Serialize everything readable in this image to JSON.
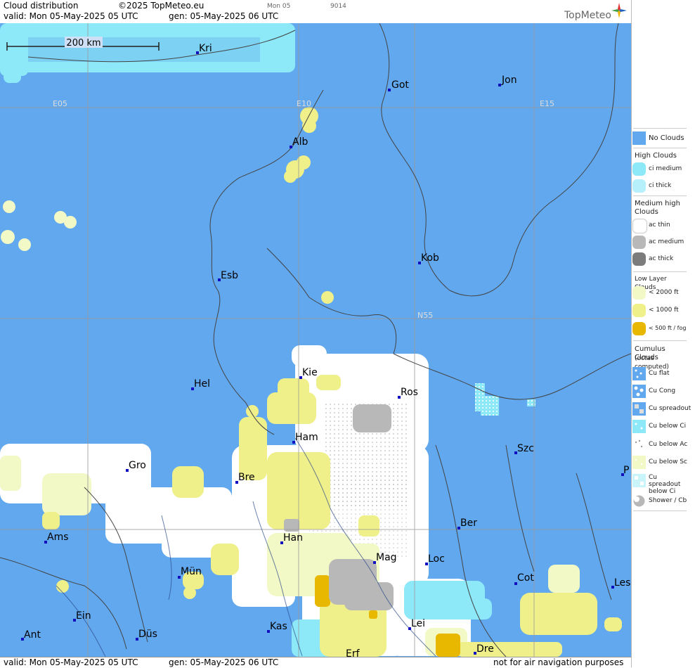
{
  "header": {
    "title": "Cloud distribution",
    "copyright": "©2025 TopMeteo.eu",
    "day_code": "Mon 05",
    "tile_code": "9014",
    "valid": "valid:  Mon  05-May-2025  05 UTC",
    "gen": "gen: 05-May-2025 06 UTC",
    "brand": "TopMeteo"
  },
  "footer": {
    "valid": "valid:  Mon  05-May-2025  05 UTC",
    "gen": "gen: 05-May-2025 06 UTC",
    "disclaimer": "not for air navigation purposes"
  },
  "map": {
    "scale_label": "200 km",
    "grid_labels": [
      "E05",
      "E10",
      "E15",
      "N55"
    ],
    "cities": [
      "Kri",
      "Got",
      "Jon",
      "Alb",
      "Kob",
      "Esb",
      "Kie",
      "Hel",
      "Ros",
      "Ham",
      "Szc",
      "Gro",
      "Bre",
      "P",
      "Ber",
      "Han",
      "Ams",
      "Mag",
      "Loc",
      "Mün",
      "Cot",
      "Les",
      "Ein",
      "Lei",
      "Kas",
      "Ant",
      "Düs",
      "Dre",
      "Erf"
    ]
  },
  "colors": {
    "no_clouds": "#62a8ee",
    "ci_medium": "#8de8f8",
    "ac_thin": "#ffffff",
    "ac_medium": "#b8b8b8",
    "low_2000": "#f2f8c6",
    "low_1000": "#f0f08a",
    "low_500": "#e8b800"
  },
  "legend": {
    "no_clouds": "No Clouds",
    "high_head": "High Clouds",
    "ci_medium": "ci medium",
    "ci_thick": "ci thick",
    "medium_head": "Medium high Clouds",
    "ac_thin": "ac thin",
    "ac_medium": "ac medium",
    "ac_thick": "ac thick",
    "low_head": "Low Layer Clouds",
    "low_2000": "< 2000 ft",
    "low_1000": "< 1000 ft",
    "low_500": "< 500 ft / fog",
    "cu_head": "Cumulus Clouds",
    "cu_sub": "(octas computed)",
    "cu_flat": "Cu flat",
    "cu_cong": "Cu Cong",
    "cu_spreadout": "Cu spreadout",
    "cu_below_ci": "Cu below Ci",
    "cu_below_ac": "Cu below Ac",
    "cu_below_sc": "Cu below Sc",
    "cu_spread_below_ci": "Cu spreadout below Ci",
    "shower_cb": "Shower / Cb"
  }
}
